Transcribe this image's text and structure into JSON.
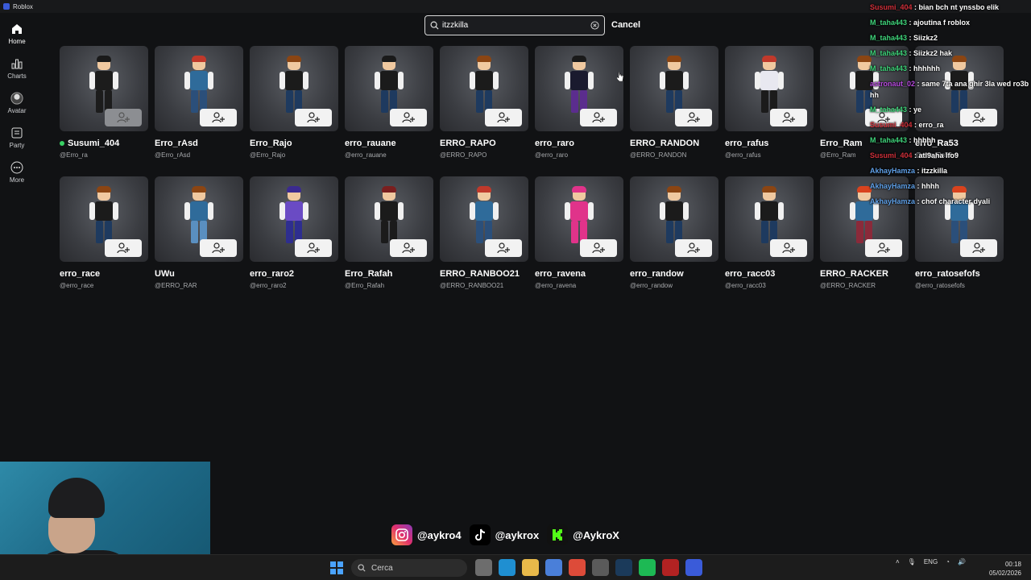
{
  "window": {
    "title": "Roblox"
  },
  "nav": [
    {
      "label": "Home",
      "icon": "home-icon"
    },
    {
      "label": "Charts",
      "icon": "charts-icon"
    },
    {
      "label": "Avatar",
      "icon": "avatar-icon"
    },
    {
      "label": "Party",
      "icon": "party-icon"
    },
    {
      "label": "More",
      "icon": "more-icon"
    }
  ],
  "search": {
    "value": "itzzkilla",
    "cancel_label": "Cancel"
  },
  "results": [
    {
      "name": "Susumi_404",
      "handle": "@Erro_ra",
      "online": true,
      "added": true,
      "hair": "#1a1a1a",
      "shirt": "#1c1c1c",
      "legs": "#1c1c1c"
    },
    {
      "name": "Erro_rAsd",
      "handle": "@Erro_rAsd",
      "hair": "#c0392b",
      "shirt": "#2f6b9a",
      "legs": "#2b4f7a"
    },
    {
      "name": "Erro_Rajo",
      "handle": "@Erro_Rajo",
      "hair": "#8b4513",
      "shirt": "#1b1b1b",
      "legs": "#1e3a5f"
    },
    {
      "name": "erro_rauane",
      "handle": "@erro_rauane",
      "hair": "#1a1a1a",
      "shirt": "#1b1b1b",
      "legs": "#1e3a5f"
    },
    {
      "name": "ERRO_RAPO",
      "handle": "@ERRO_RAPO",
      "hair": "#8b4513",
      "shirt": "#1b1b1b",
      "legs": "#1e3a5f"
    },
    {
      "name": "erro_raro",
      "handle": "@erro_raro",
      "hair": "#1a1a1a",
      "shirt": "#1a1a2e",
      "legs": "#5b2d8e"
    },
    {
      "name": "ERRO_RANDON",
      "handle": "@ERRO_RANDON",
      "hair": "#8b4513",
      "shirt": "#1b1b1b",
      "legs": "#1e3a5f"
    },
    {
      "name": "erro_rafus",
      "handle": "@erro_rafus",
      "hair": "#c0392b",
      "shirt": "#e8e8f0",
      "legs": "#1b1b1b"
    },
    {
      "name": "Erro_Ram",
      "handle": "@Erro_Ram",
      "hair": "#8b4513",
      "shirt": "#1b1b1b",
      "legs": "#1e3a5f"
    },
    {
      "name": "erro_Ra53",
      "handle": "@erro_Ra53",
      "hair": "#8b4513",
      "shirt": "#1b1b1b",
      "legs": "#1e3a5f"
    },
    {
      "name": "erro_race",
      "handle": "@erro_race",
      "hair": "#8b4513",
      "shirt": "#1b1b1b",
      "legs": "#1e3a5f"
    },
    {
      "name": "UWu",
      "handle": "@ERRO_RAR",
      "hair": "#8b4513",
      "shirt": "#2f6b9a",
      "legs": "#5a8fc0"
    },
    {
      "name": "erro_raro2",
      "handle": "@erro_raro2",
      "hair": "#3b2a8f",
      "shirt": "#6a4bc4",
      "legs": "#2e2e8f"
    },
    {
      "name": "Erro_Rafah",
      "handle": "@Erro_Rafah",
      "hair": "#7a1f1f",
      "shirt": "#1b1b1b",
      "legs": "#1b1b1b"
    },
    {
      "name": "ERRO_RANBOO21",
      "handle": "@ERRO_RANBOO21",
      "hair": "#c0392b",
      "shirt": "#2f6b9a",
      "legs": "#2b4f7a"
    },
    {
      "name": "erro_ravena",
      "handle": "@erro_ravena",
      "hair": "#e0338a",
      "shirt": "#e0338a",
      "legs": "#e0338a"
    },
    {
      "name": "erro_randow",
      "handle": "@erro_randow",
      "hair": "#8b4513",
      "shirt": "#1b1b1b",
      "legs": "#1e3a5f"
    },
    {
      "name": "erro_racc03",
      "handle": "@erro_racc03",
      "hair": "#8b4513",
      "shirt": "#1b1b1b",
      "legs": "#1e3a5f"
    },
    {
      "name": "ERRO_RACKER",
      "handle": "@ERRO_RACKER",
      "hair": "#d9431e",
      "shirt": "#2f6b9a",
      "legs": "#8a2a3a"
    },
    {
      "name": "erro_ratosefofs",
      "handle": "@erro_ratosefofs",
      "hair": "#d9431e",
      "shirt": "#2f6b9a",
      "legs": "#2b4f7a"
    }
  ],
  "chat": [
    {
      "user": "Susumi_404",
      "text": "bian bch nt ynssbo elik",
      "color": "#d0303a"
    },
    {
      "user": "M_taha443",
      "text": "ajoutina f roblox",
      "color": "#3fd37a"
    },
    {
      "user": "M_taha443",
      "text": "Siizkz2",
      "color": "#3fd37a"
    },
    {
      "user": "M_taha443",
      "text": "Siizkz2 hak",
      "color": "#3fd37a"
    },
    {
      "user": "M_taha443",
      "text": "hhhhhh",
      "color": "#3fd37a"
    },
    {
      "user": "astronaut_02",
      "text": "same 7ta ana ghir 3la wed ro3b hh",
      "color": "#b84be0",
      "wrap": true
    },
    {
      "user": "M_taha443",
      "text": "ye",
      "color": "#3fd37a"
    },
    {
      "user": "Susumi_404",
      "text": "erro_ra",
      "color": "#d0303a"
    },
    {
      "user": "M_taha443",
      "text": "hhhhh",
      "color": "#3fd37a"
    },
    {
      "user": "Susumi_404",
      "text": "atl9aha lfo9",
      "color": "#d0303a"
    },
    {
      "user": "AkhayHamza",
      "text": "itzzkilla",
      "color": "#5fa0e8"
    },
    {
      "user": "AkhayHamza",
      "text": "hhhh",
      "color": "#5fa0e8"
    },
    {
      "user": "AkhayHamza",
      "text": "chof character dyali",
      "color": "#5fa0e8"
    }
  ],
  "socials": [
    {
      "handle": "@aykro4",
      "icon": "instagram-icon",
      "color": "#e1306c"
    },
    {
      "handle": "@aykrox",
      "icon": "tiktok-icon",
      "color": "#000000"
    },
    {
      "handle": "@AykroX",
      "icon": "kick-icon",
      "color": "#111111"
    }
  ],
  "taskbar": {
    "search_placeholder": "Cerca",
    "language": "ENG",
    "time": "00:18",
    "date": "05/02/2026",
    "apps": [
      "file-explorer-icon",
      "edge-icon",
      "folder-icon",
      "store-icon",
      "chrome-icon",
      "github-icon",
      "steam-icon",
      "spotify-icon",
      "app-icon",
      "roblox-icon"
    ]
  }
}
